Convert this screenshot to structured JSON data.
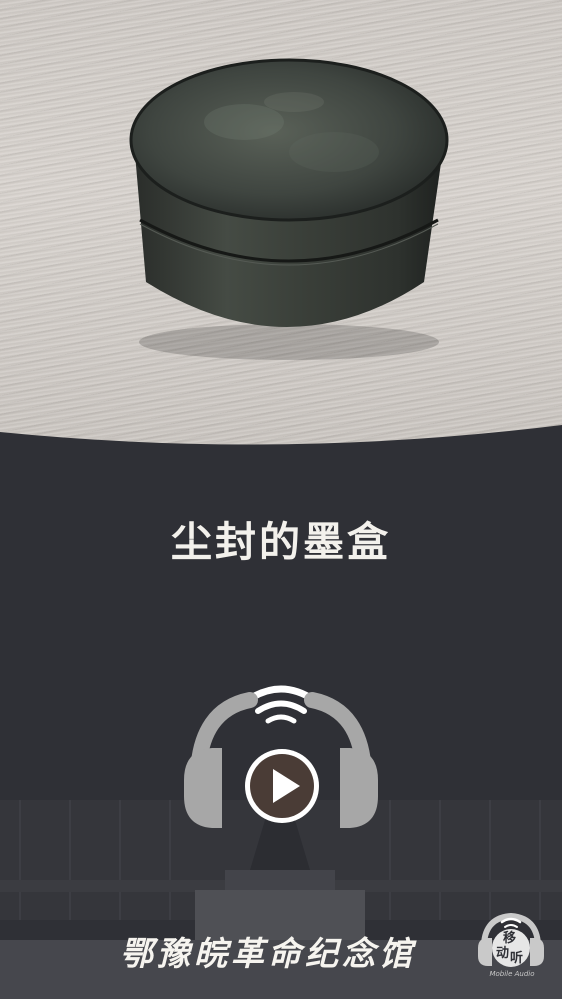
{
  "artifact": {
    "title": "尘封的墨盒"
  },
  "museum": {
    "name": "鄂豫皖革命纪念馆"
  },
  "logo": {
    "char1": "移",
    "char2": "动",
    "char3": "听",
    "english": "Mobile Audio"
  },
  "icons": {
    "headphones": "headphones-icon",
    "wifi": "wifi-signal-icon",
    "play": "play-icon"
  },
  "colors": {
    "panel_bg": "#2f3036",
    "headphone_gray": "#a7a7a7",
    "play_inner": "#4a3c36",
    "title_text": "#f3f1ec"
  }
}
